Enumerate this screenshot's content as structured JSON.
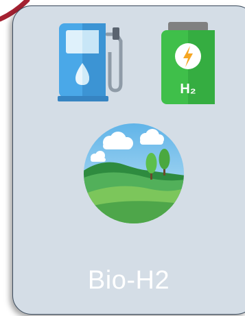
{
  "card": {
    "label": "Bio-H2"
  },
  "icons": {
    "fuel_pump": "fuel-pump-icon",
    "hydrogen_battery": "hydrogen-battery-icon",
    "battery_text": "H₂",
    "landscape": "green-landscape-icon"
  },
  "colors": {
    "card_background": "#d4dde6",
    "card_border": "#3a4a5c",
    "accent_red": "#a52232",
    "pump_blue": "#4aa8e8",
    "battery_green": "#3fbf4a"
  }
}
